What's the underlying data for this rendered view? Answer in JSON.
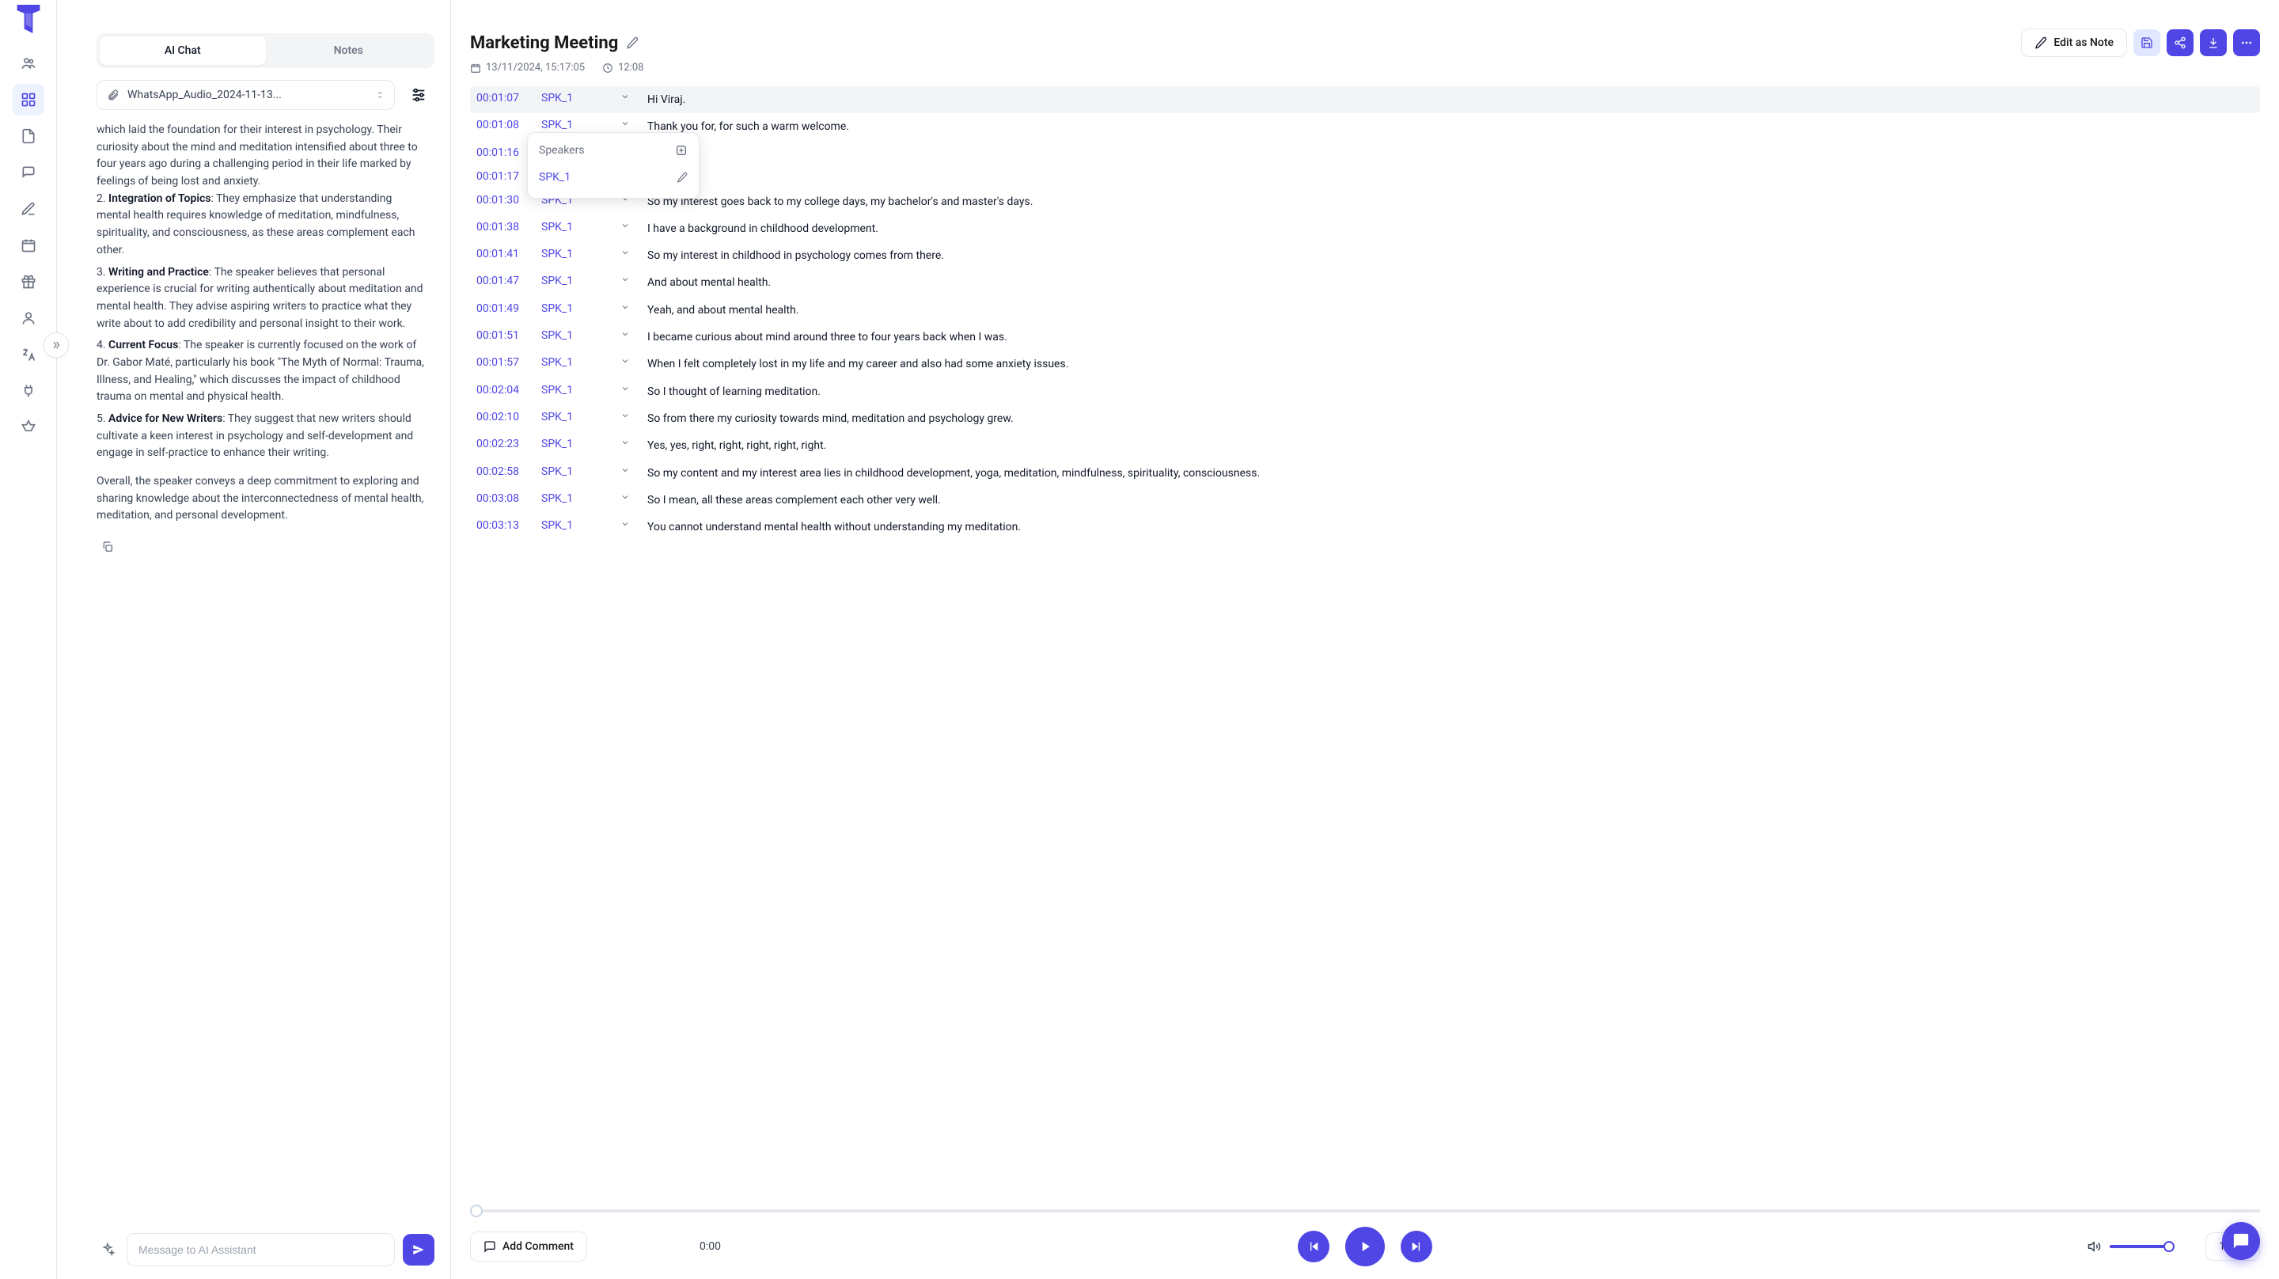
{
  "tabs": {
    "chat": "AI Chat",
    "notes": "Notes"
  },
  "file": {
    "name": "WhatsApp_Audio_2024-11-13..."
  },
  "ai_response": {
    "intro_fragment": "which laid the foundation for their interest in psychology. Their curiosity about the mind and meditation intensified about three to four years ago during a challenging period in their life marked by feelings of being lost and anxiety.",
    "points": [
      {
        "n": "2.",
        "title": "Integration of Topics",
        "body": ": They emphasize that understanding mental health requires knowledge of meditation, mindfulness, spirituality, and consciousness, as these areas complement each other."
      },
      {
        "n": "3.",
        "title": "Writing and Practice",
        "body": ": The speaker believes that personal experience is crucial for writing authentically about meditation and mental health. They advise aspiring writers to practice what they write about to add credibility and personal insight to their work."
      },
      {
        "n": "4.",
        "title": "Current Focus",
        "body": ": The speaker is currently focused on the work of Dr. Gabor Maté, particularly his book \"The Myth of Normal: Trauma, Illness, and Healing,\" which discusses the impact of childhood trauma on mental and physical health."
      },
      {
        "n": "5.",
        "title": "Advice for New Writers",
        "body": ": They suggest that new writers should cultivate a keen interest in psychology and self-development and engage in self-practice to enhance their writing."
      }
    ],
    "summary": "Overall, the speaker conveys a deep commitment to exploring and sharing knowledge about the interconnectedness of mental health, meditation, and personal development."
  },
  "chat_input": {
    "placeholder": "Message to AI Assistant"
  },
  "doc": {
    "title": "Marketing Meeting",
    "date": "13/11/2024, 15:17:05",
    "duration": "12:08",
    "edit_as_note": "Edit as Note"
  },
  "speakers_popup": {
    "heading": "Speakers",
    "item": "SPK_1"
  },
  "transcript": [
    {
      "t": "00:01:07",
      "s": "SPK_1",
      "txt": "Hi Viraj.",
      "hl": true
    },
    {
      "t": "00:01:08",
      "s": "SPK_1",
      "txt": "Thank you for, for such a warm welcome."
    },
    {
      "t": "00:01:16",
      "s": "",
      "txt": ""
    },
    {
      "t": "00:01:17",
      "s": "",
      "txt": ""
    },
    {
      "t": "00:01:30",
      "s": "SPK_1",
      "txt": "So my interest goes back to my college days, my bachelor's and master's days."
    },
    {
      "t": "00:01:38",
      "s": "SPK_1",
      "txt": "I have a background in childhood development."
    },
    {
      "t": "00:01:41",
      "s": "SPK_1",
      "txt": "So my interest in childhood in psychology comes from there."
    },
    {
      "t": "00:01:47",
      "s": "SPK_1",
      "txt": "And about mental health."
    },
    {
      "t": "00:01:49",
      "s": "SPK_1",
      "txt": "Yeah, and about mental health."
    },
    {
      "t": "00:01:51",
      "s": "SPK_1",
      "txt": "I became curious about mind around three to four years back when I was."
    },
    {
      "t": "00:01:57",
      "s": "SPK_1",
      "txt": "When I felt completely lost in my life and my career and also had some anxiety issues."
    },
    {
      "t": "00:02:04",
      "s": "SPK_1",
      "txt": "So I thought of learning meditation."
    },
    {
      "t": "00:02:10",
      "s": "SPK_1",
      "txt": "So from there my curiosity towards mind, meditation and psychology grew."
    },
    {
      "t": "00:02:23",
      "s": "SPK_1",
      "txt": "Yes, yes, right, right, right, right, right."
    },
    {
      "t": "00:02:58",
      "s": "SPK_1",
      "txt": "So my content and my interest area lies in childhood development, yoga, meditation, mindfulness, spirituality, consciousness."
    },
    {
      "t": "00:03:08",
      "s": "SPK_1",
      "txt": "So I mean, all these areas complement each other very well."
    },
    {
      "t": "00:03:13",
      "s": "SPK_1",
      "txt": "You cannot understand mental health without understanding my meditation."
    }
  ],
  "player": {
    "add_comment": "Add Comment",
    "current_time": "0:00",
    "speed": "1x"
  }
}
